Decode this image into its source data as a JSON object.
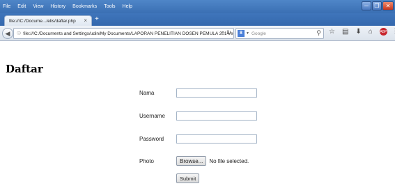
{
  "menu": {
    "items": [
      {
        "label": "File"
      },
      {
        "label": "Edit"
      },
      {
        "label": "View"
      },
      {
        "label": "History"
      },
      {
        "label": "Bookmarks"
      },
      {
        "label": "Tools"
      },
      {
        "label": "Help"
      }
    ]
  },
  "tabs": [
    {
      "label": "file:///C:/Docume.../elis/daftar.php",
      "close": "×"
    }
  ],
  "new_tab": "+",
  "navbar": {
    "url": "file:///C:/Documents and Settings/udin/My Documents/LAPORAN PENELITIAN DOSEN PEMULA  2014/eli",
    "search_placeholder": "Google",
    "search_engine_letter": "8"
  },
  "page": {
    "title": "Daftar"
  },
  "form": {
    "nama_label": "Nama",
    "username_label": "Username",
    "password_label": "Password",
    "photo_label": "Photo",
    "browse_label": "Browse...",
    "no_file_text": "No file selected.",
    "submit_label": "Submit"
  }
}
